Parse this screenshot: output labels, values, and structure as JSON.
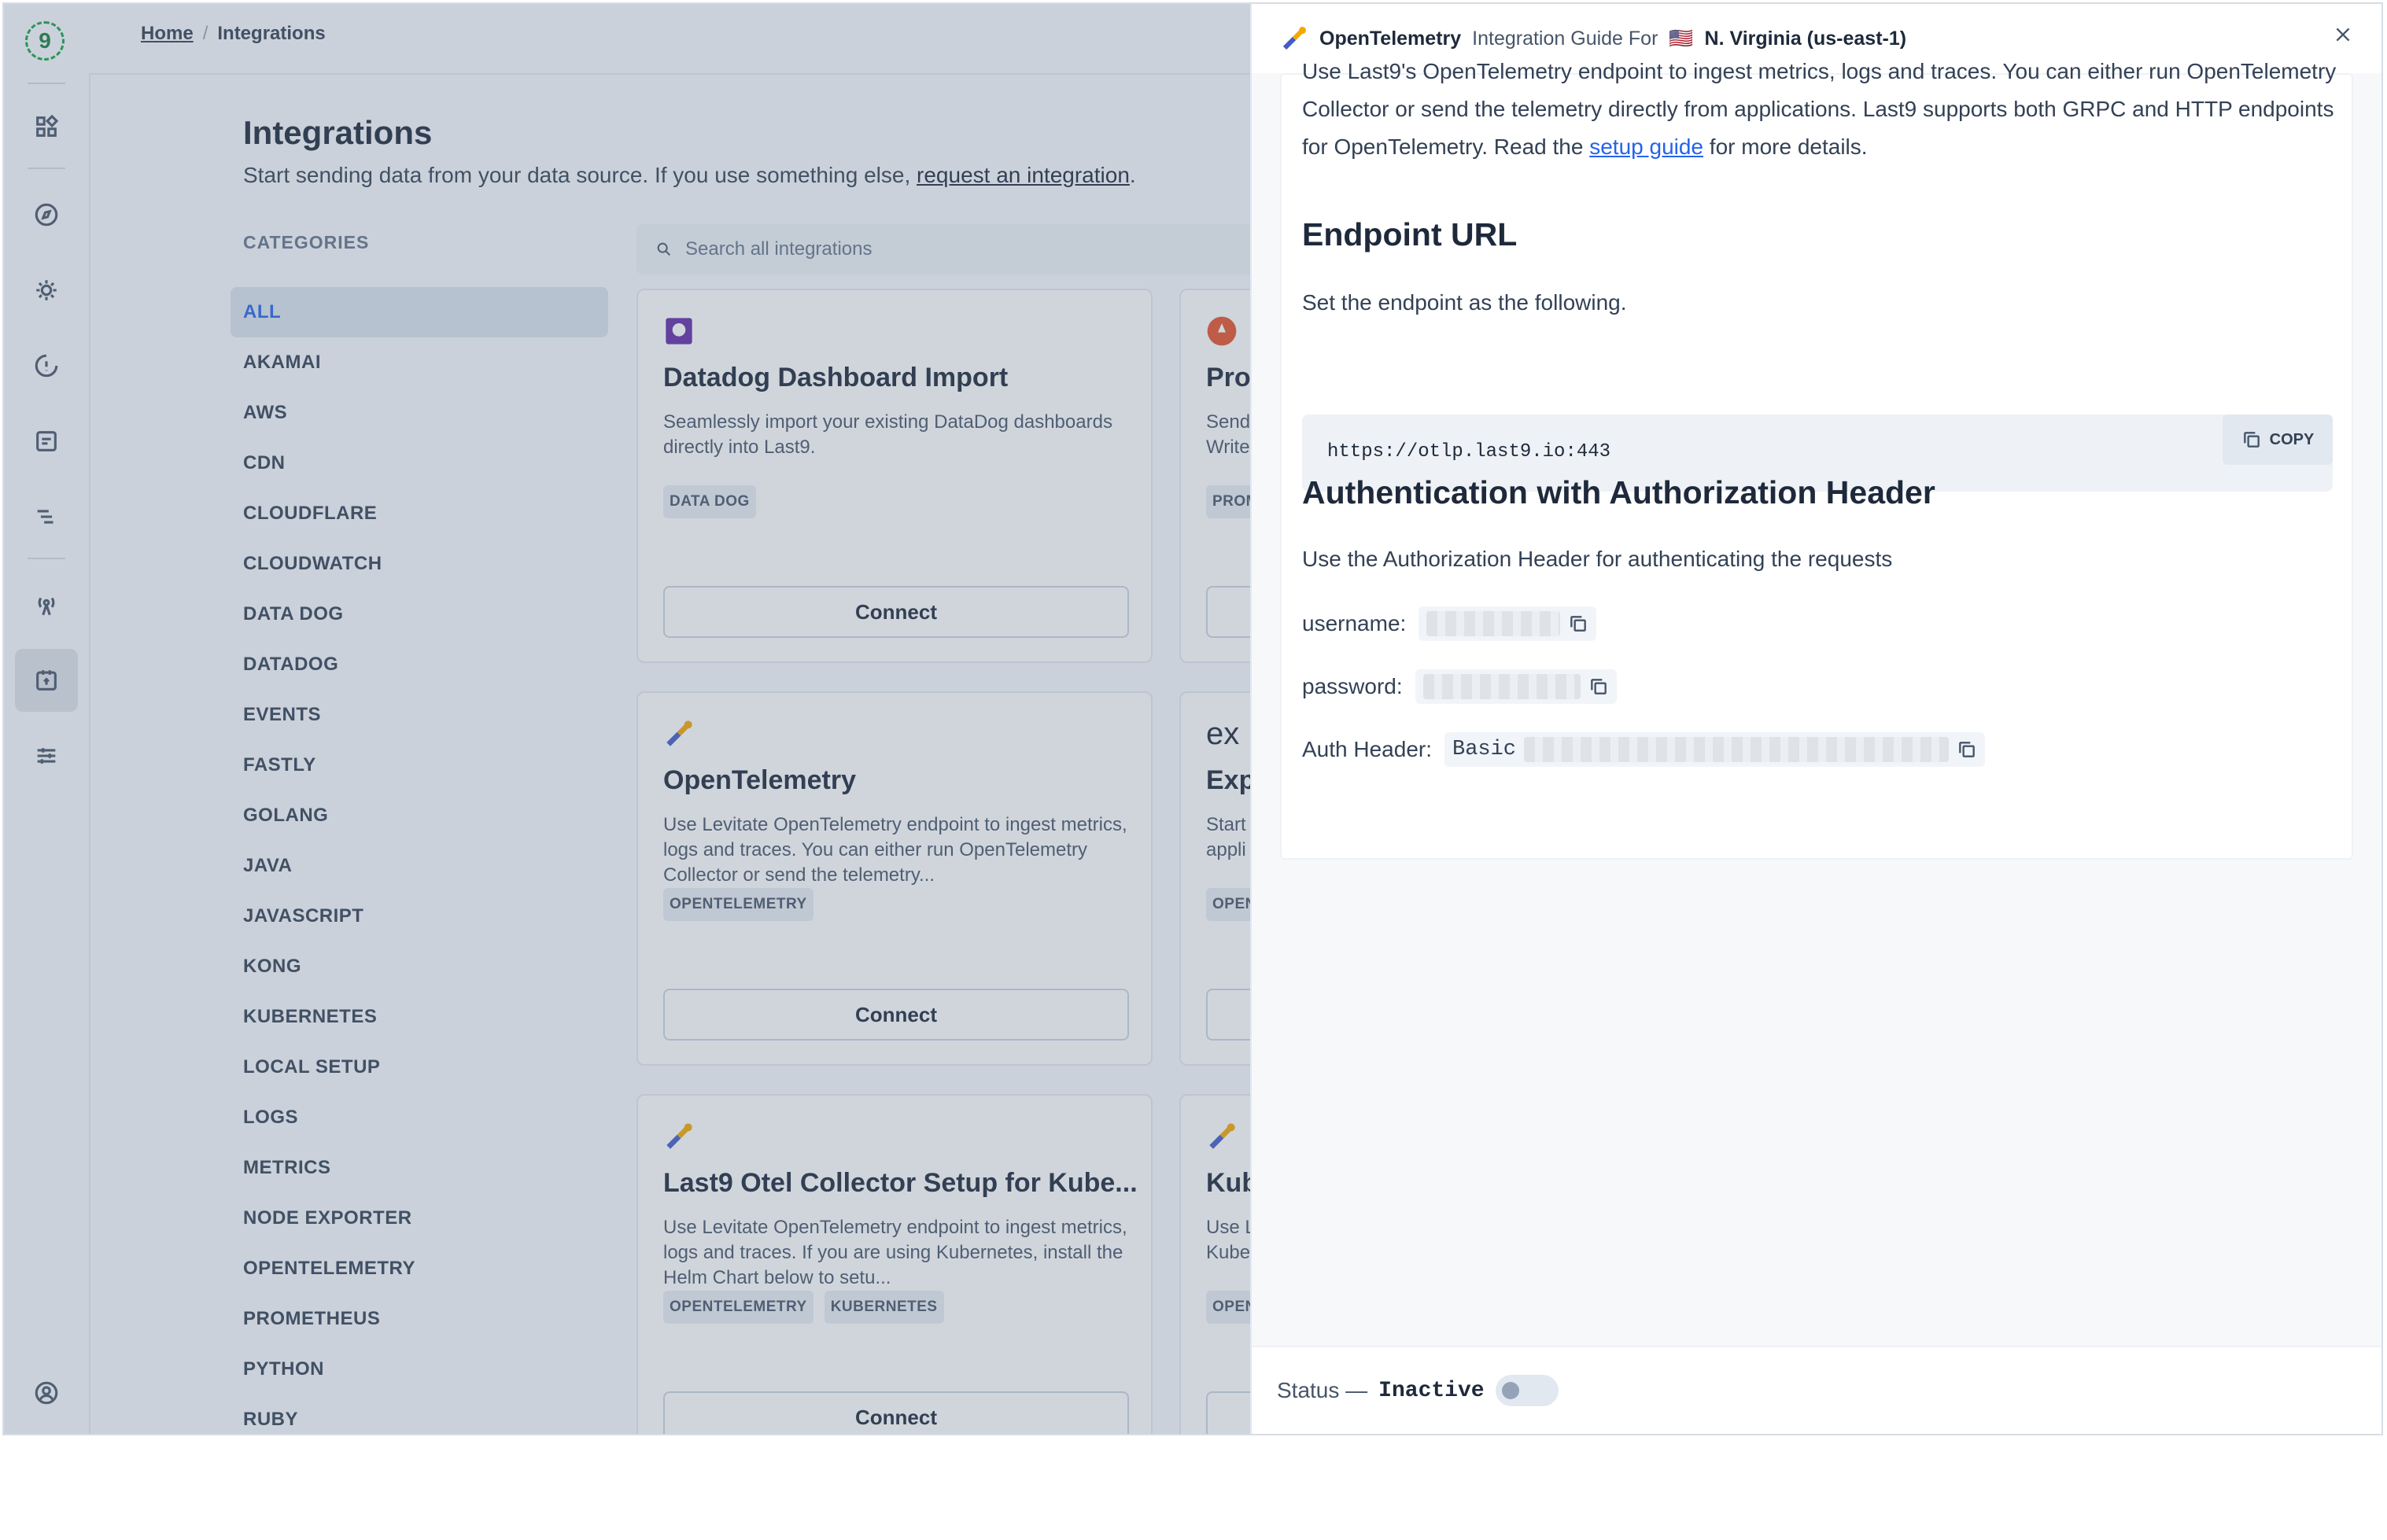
{
  "breadcrumb": {
    "home": "Home",
    "separator": "/",
    "current": "Integrations"
  },
  "page": {
    "title": "Integrations",
    "subtitle_prefix": "Start sending data from your data source. If you use something else, ",
    "subtitle_link": "request an integration",
    "subtitle_suffix": "."
  },
  "categories": {
    "heading": "CATEGORIES",
    "items": [
      "ALL",
      "AKAMAI",
      "AWS",
      "CDN",
      "CLOUDFLARE",
      "CLOUDWATCH",
      "DATA DOG",
      "DATADOG",
      "EVENTS",
      "FASTLY",
      "GOLANG",
      "JAVA",
      "JAVASCRIPT",
      "KONG",
      "KUBERNETES",
      "LOCAL SETUP",
      "LOGS",
      "METRICS",
      "NODE EXPORTER",
      "OPENTELEMETRY",
      "PROMETHEUS",
      "PYTHON",
      "RUBY"
    ],
    "active": "ALL"
  },
  "search": {
    "placeholder": "Search all integrations"
  },
  "cards": [
    {
      "title": "Datadog Dashboard Import",
      "desc": "Seamlessly import your existing DataDog dashboards directly into Last9.",
      "tags": [
        "DATA DOG"
      ],
      "button": "Connect"
    },
    {
      "title": "Prom",
      "desc": "Send\nWrite",
      "tags": [
        "PROM"
      ],
      "button": ""
    },
    {
      "title": "OpenTelemetry",
      "desc": "Use Levitate OpenTelemetry endpoint to ingest metrics, logs and traces. You can either run OpenTelemetry Collector or send the telemetry...",
      "tags": [
        "OPENTELEMETRY"
      ],
      "button": "Connect"
    },
    {
      "title": "Exp",
      "desc": "Start\nappli",
      "tags": [
        "OPEN"
      ],
      "button": ""
    },
    {
      "title": "Last9 Otel Collector Setup for Kube...",
      "desc": "Use Levitate OpenTelemetry endpoint to ingest metrics, logs and traces. If you are using Kubernetes, install the Helm Chart below to setu...",
      "tags": [
        "OPENTELEMETRY",
        "KUBERNETES"
      ],
      "button": "Connect"
    },
    {
      "title": "Kub",
      "desc": "Use L\nKube",
      "tags": [
        "OPEN"
      ],
      "button": ""
    }
  ],
  "panel": {
    "integration_name": "OpenTelemetry",
    "guide_label": "Integration Guide For",
    "region_flag": "🇺🇸",
    "region": "N. Virginia (us-east-1)",
    "intro_text": "Use Last9's OpenTelemetry endpoint to ingest metrics, logs and traces. You can either run OpenTelemetry Collector or send the telemetry directly from applications. Last9 supports both GRPC and HTTP endpoints for OpenTelemetry. Read the ",
    "intro_link": "setup guide",
    "intro_suffix": " for more details.",
    "endpoint_heading": "Endpoint URL",
    "endpoint_text": "Set the endpoint as the following.",
    "endpoint_url": "https://otlp.last9.io:443",
    "copy_label": "COPY",
    "auth_heading": "Authentication with Authorization Header",
    "auth_text": "Use the Authorization Header for authenticating the requests",
    "username_label": "username:",
    "password_label": "password:",
    "auth_header_label": "Auth Header:",
    "auth_header_prefix": "Basic"
  },
  "status": {
    "label": "Status —",
    "value": "Inactive",
    "enabled": false
  },
  "colors": {
    "accent": "#2563eb",
    "logo": "#16a34a",
    "tag_bg": "#e8edf2"
  }
}
